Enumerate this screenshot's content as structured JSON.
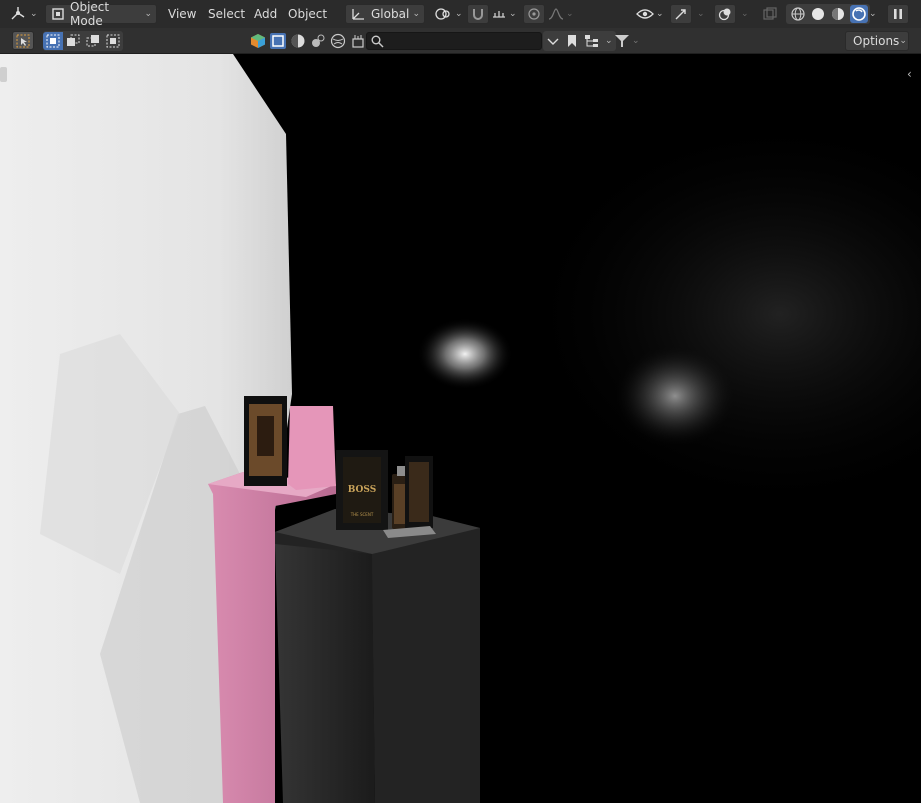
{
  "header": {
    "editor_type_icon": "3d-viewport-icon",
    "mode": {
      "label": "Object Mode",
      "icon": "object-mode-icon"
    },
    "menus": [
      "View",
      "Select",
      "Add",
      "Object"
    ],
    "transform_orientation": {
      "label": "Global",
      "icon": "transform-axes-icon"
    },
    "pivot_icon": "pivot-point-icon",
    "snap_icon": "snap-magnet-icon",
    "snap_target_icon": "snap-increment-icon",
    "proportional_icon": "proportional-edit-icon",
    "falloff_icon": "falloff-curve-icon",
    "visibility_icon": "eye-visibility-icon",
    "gizmo_icon": "gizmo-arrow-icon",
    "overlay_icon": "overlays-icon",
    "xray_icon": "xray-icon",
    "shading_modes": [
      "wireframe-icon",
      "solid-icon",
      "material-preview-icon",
      "rendered-icon"
    ],
    "active_shading": "rendered-icon",
    "pause_icon": "pause-icon"
  },
  "toolbar2": {
    "select_tool_icon": "select-box-tool-icon",
    "select_modes": [
      "select-new-icon",
      "select-extend-icon",
      "select-subtract-icon",
      "select-intersect-icon"
    ],
    "outliner_icons": [
      "cube-object-icon",
      "square-filled-icon",
      "sphere-material-icon",
      "lights-icon",
      "world-icon",
      "scene-icon"
    ],
    "search": {
      "placeholder": "",
      "value": ""
    },
    "filter_icon": "filter-funnel-icon",
    "options_label": "Options"
  },
  "scene": {
    "box_label": "BOSS",
    "box_sub": "THE SCENT"
  },
  "colors": {
    "header_bg": "#2b2b2b",
    "button_bg": "#3d3d3d",
    "accent_blue": "#4772b3",
    "pink_pedestal": "#cf7ea3",
    "dark_pedestal": "#2c2c2c"
  }
}
